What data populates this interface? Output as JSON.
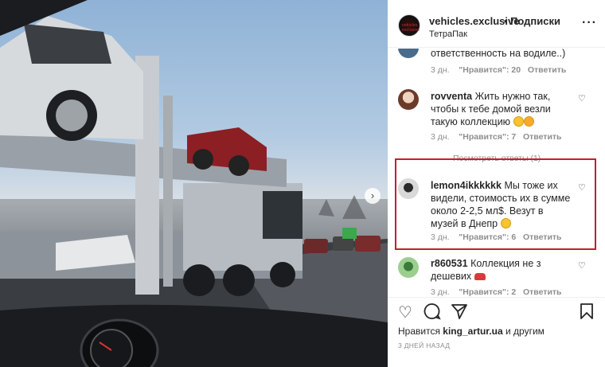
{
  "photo": {
    "alt_icon": "chevron-right-icon"
  },
  "header": {
    "username": "vehicles.exclusive",
    "dot": "•",
    "follow": "Подписки",
    "location": "ТетраПак",
    "avatar_text": "vehicles exclusive",
    "more": "···"
  },
  "comments": [
    {
      "user": "",
      "text": "ответственность на водиле..)",
      "time": "3 дн.",
      "likes": "\"Нравится\": 20",
      "reply": "Ответить"
    },
    {
      "user": "rovventa",
      "text": "Жить нужно так, чтобы к тебе домой везли такую коллекцию",
      "time": "3 дн.",
      "likes": "\"Нравится\": 7",
      "reply": "Ответить",
      "view_replies": "Посмотреть ответы (1)"
    },
    {
      "user": "lemon4ikkkkkk",
      "text": "Мы тоже их видели, стоимость их в сумме около 2-2,5 мл$. Везут в музей в Днепр",
      "time": "3 дн.",
      "likes": "\"Нравится\": 6",
      "reply": "Ответить"
    },
    {
      "user": "r860531",
      "text": "Коллекция не з дешевих",
      "time": "3 дн.",
      "likes": "\"Нравится\": 2",
      "reply": "Ответить"
    }
  ],
  "footer": {
    "likes_prefix": "Нравится",
    "likes_user": "king_artur.ua",
    "likes_suffix": "и другим",
    "date": "3 ДНЕЙ НАЗАД"
  }
}
